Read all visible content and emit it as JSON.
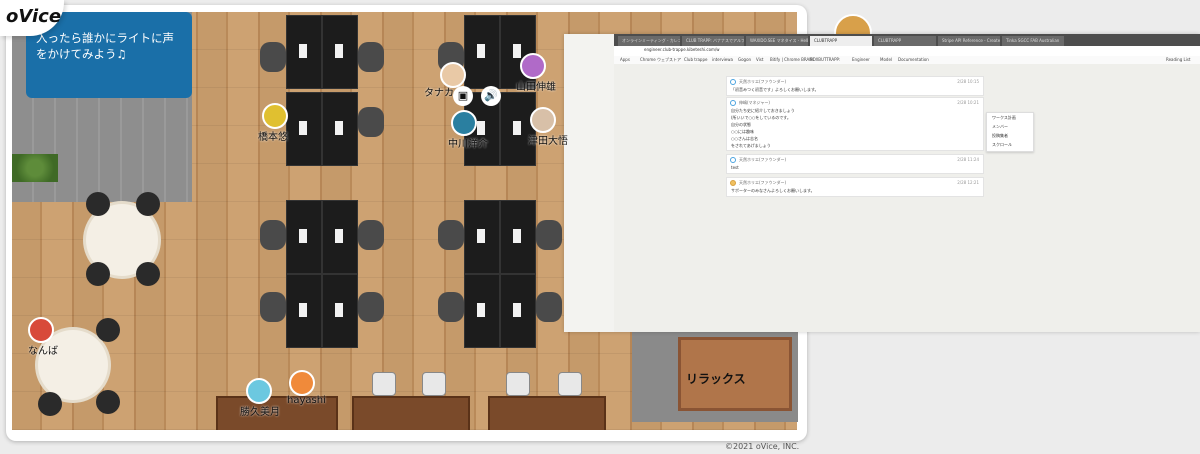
{
  "app": {
    "logo": "oVice",
    "copyright": "©2021 oVice, INC."
  },
  "instruction": {
    "text": "入ったら誰かにライトに声をかけてみよう♫"
  },
  "avatars": [
    {
      "name": "タナカダ"
    },
    {
      "name": "山田伸雄"
    },
    {
      "name": "橋本悠"
    },
    {
      "name": "中川洋介"
    },
    {
      "name": "津田大悟"
    },
    {
      "name": "なんば"
    },
    {
      "name": "勝久美月"
    },
    {
      "name": "hayashi"
    }
  ],
  "relax_area": {
    "label": "リラックス"
  },
  "controls": {
    "screen_icon": "monitor-icon",
    "volume_icon": "speaker-icon"
  },
  "shared_screen": {
    "tabs": [
      "オンラインミーティング - カレンダー",
      "CLUB TRAPP: バナナスでアルファ",
      "WAXIDO.SEE マネタイス - HelBi",
      "CLUBTRAPP",
      "CLUBTRAPP",
      "Stripe API Reference - Create a",
      "Tinka SGCC FAB Australian"
    ],
    "url": "engineer.club-trappe.kibeteshi.com/w",
    "bookmarks": [
      "Apps",
      "Chrome ウェブストア",
      "Club trappe",
      "interviewa",
      "Gogon",
      "Vist",
      "Bitify | Chrome BRAMI",
      "BOXBUTTRAPP:",
      "Engineer",
      "Model",
      "Documentation",
      "Reading List"
    ],
    "messages": [
      {
        "name": "天然ホリエ(ファウンダー)",
        "time": "2/28 10:15",
        "lines": [
          "「初音みつく初音です」よろしくお願いします。"
        ]
      },
      {
        "name": "伸嶋(マネジャー)",
        "time": "2/28 10:21",
        "lines": [
          "自分たち史に紹介しておきましょう",
          "(所いいで○○をしているのです。",
          "自分の状態",
          "○○には趣味",
          "○○さんは志名",
          "をされてあげましょう"
        ]
      },
      {
        "name": "天然ホリエ(ファウンダー)",
        "time": "2/28 11:24",
        "lines": [
          "test"
        ]
      },
      {
        "name": "天然ホリエ(ファウンダー)",
        "time": "2/28 12:21",
        "lines": [
          "サポーターのみなさんよろしくお願いします。"
        ]
      }
    ],
    "context_menu": [
      "ワークス計画",
      "メンバー",
      "投稿集者",
      "スクロール"
    ]
  }
}
